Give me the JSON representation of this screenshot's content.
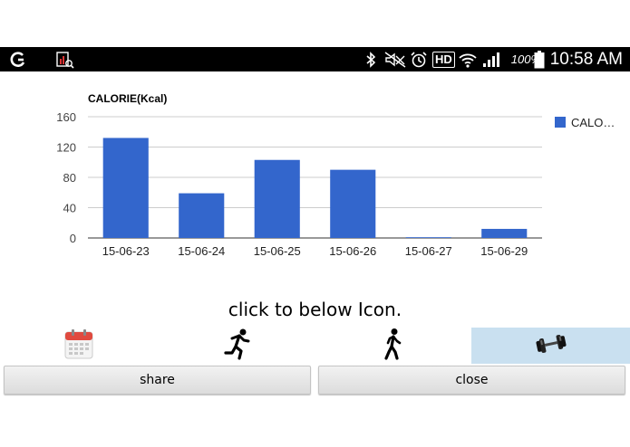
{
  "status_bar": {
    "time": "10:58 AM",
    "battery": "100%",
    "left_icons": [
      "notification-g-icon",
      "screenshot-chart-icon"
    ],
    "right_icons": [
      "bluetooth-icon",
      "mute-icon",
      "alarm-icon",
      "hd-icon",
      "wifi-icon",
      "signal-icon",
      "battery-icon"
    ],
    "hd_label": "HD"
  },
  "chart_data": {
    "type": "bar",
    "title": "CALORIE(Kcal)",
    "categories": [
      "15-06-23",
      "15-06-24",
      "15-06-25",
      "15-06-26",
      "15-06-27",
      "15-06-29"
    ],
    "series": [
      {
        "name": "CALO…",
        "values": [
          132,
          59,
          103,
          90,
          1,
          12
        ],
        "color": "#3366cc"
      }
    ],
    "ylim": [
      0,
      160
    ],
    "yticks": [
      "0",
      "40",
      "80",
      "120",
      "160"
    ],
    "grid": true,
    "legend": "right"
  },
  "instruction": "click to below Icon.",
  "icon_tabs": [
    {
      "name": "calendar-icon"
    },
    {
      "name": "running-icon"
    },
    {
      "name": "walking-icon"
    },
    {
      "name": "dumbbell-icon",
      "selected": true
    }
  ],
  "buttons": {
    "share": "share",
    "close": "close"
  },
  "colors": {
    "bar": "#3366cc",
    "selected_tab": "#c9e0f0",
    "status_bar": "#000000"
  }
}
